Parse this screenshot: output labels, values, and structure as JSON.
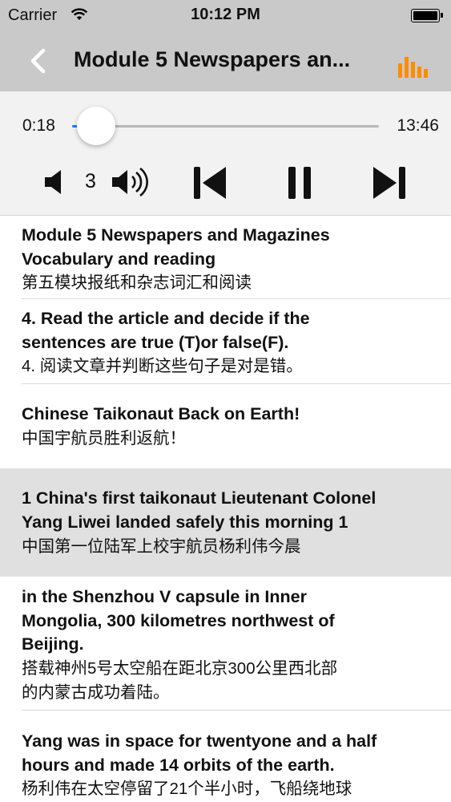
{
  "status_bar": {
    "carrier": "Carrier",
    "time": "10:12 PM"
  },
  "nav": {
    "title": "Module 5 Newspapers an...",
    "back_icon": "chevron-left-icon",
    "menu_icon": "equalizer-icon",
    "accent": "#ff8c00"
  },
  "player": {
    "current_time": "0:18",
    "duration": "13:46",
    "progress_fraction": 0.022,
    "volume": "3",
    "accent": "#1a7bff"
  },
  "sentences": [
    {
      "en": "Module 5 Newspapers and Magazines\nVocabulary and reading",
      "zh": "第五模块报纸和杂志词汇和阅读",
      "active": false
    },
    {
      "en": "4. Read the article and decide if the\nsentences are true (T)or false(F).",
      "zh": "4. 阅读文章并判断这些句子是对是错。",
      "active": false
    },
    {
      "en": "Chinese Taikonaut Back on Earth!",
      "zh": "中国宇航员胜利返航！",
      "active": false
    },
    {
      "en": "1 China's first taikonaut Lieutenant Colonel\nYang Liwei landed safely this morning 1",
      "zh": "中国第一位陆军上校宇航员杨利伟今晨",
      "active": true
    },
    {
      "en": "in the Shenzhou V capsule in Inner\nMongolia, 300 kilometres northwest of\nBeijing.",
      "zh": "搭载神州5号太空船在距北京300公里西北部\n的内蒙古成功着陆。",
      "active": false
    },
    {
      "en": "Yang was in space for twentyone and a half\nhours and made 14 orbits of the earth.",
      "zh": "杨利伟在太空停留了21个半小时，飞船绕地球",
      "active": false
    }
  ]
}
